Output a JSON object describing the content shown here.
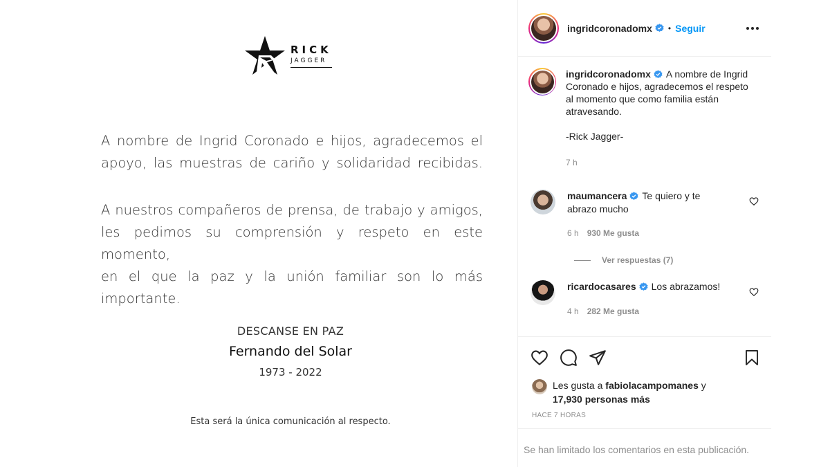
{
  "post_image": {
    "logo": {
      "main": "RICK",
      "sub": "JAGGER"
    },
    "paragraph1": [
      "A nombre de Ingrid Coronado e hijos, agradecemos el",
      "apoyo, las muestras de cariño y solidaridad recibidas."
    ],
    "paragraph2": [
      "A nuestros compañeros de prensa, de trabajo y amigos,",
      "les pedimos su comprensión y respeto en este momento,",
      "en el que la paz y la unión familiar son lo más importante."
    ],
    "rip_title": "DESCANSE EN PAZ",
    "rip_name": "Fernando del Solar",
    "rip_years": "1973 - 2022",
    "footnote": "Esta será la única comunicación al respecto."
  },
  "header": {
    "username": "ingridcoronadomx",
    "separator": "•",
    "follow_label": "Seguir"
  },
  "caption": {
    "username": "ingridcoronadomx",
    "text": "A nombre de Ingrid Coronado e hijos, agradecemos el respeto al momento que como familia están atravesando.",
    "signature": "-Rick Jagger-",
    "time": "7 h"
  },
  "comments": [
    {
      "username": "maumancera",
      "text": "Te quiero y te abrazo mucho",
      "time": "6 h",
      "likes": "930 Me gusta"
    },
    {
      "username": "ricardocasares",
      "text": "Los abrazamos!",
      "time": "4 h",
      "likes": "282 Me gusta"
    }
  ],
  "replies_label": "Ver respuestas (7)",
  "likes": {
    "prefix": "Les gusta a",
    "user": "fabiolacampomanes",
    "conjunction": "y",
    "others": "17,930 personas más"
  },
  "time_ago": "HACE 7 HORAS",
  "comments_limited": "Se han limitado los comentarios en esta publicación.",
  "colors": {
    "link_blue": "#0095f6",
    "verified_blue": "#3897f0",
    "muted": "#8e8e8e",
    "text": "#262626"
  }
}
